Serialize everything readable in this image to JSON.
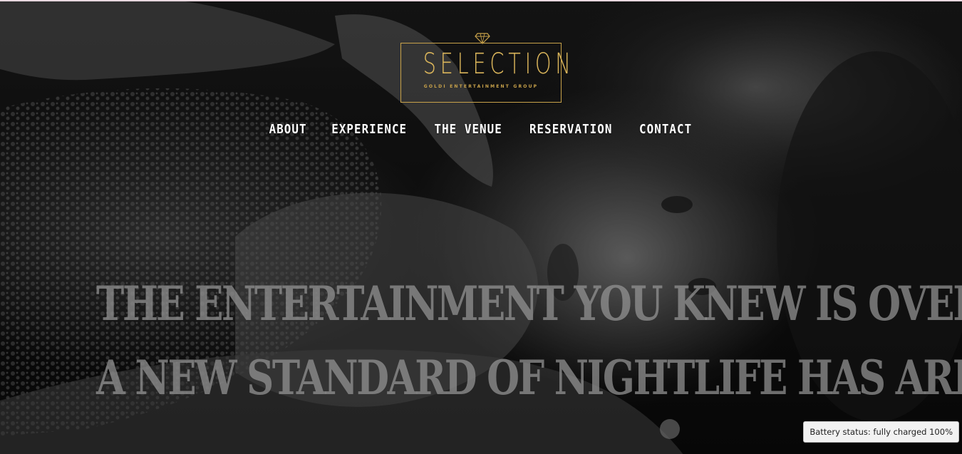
{
  "logo": {
    "wordmark": "SELECTION",
    "tagline": "GOLDI ENTERTAINMENT GROUP",
    "icon": "diamond-icon",
    "color": "#d9b45a"
  },
  "nav": {
    "items": [
      {
        "label": "ABOUT"
      },
      {
        "label": "EXPERIENCE"
      },
      {
        "label": "THE VENUE"
      },
      {
        "label": "RESERVATION"
      },
      {
        "label": "CONTACT"
      }
    ]
  },
  "hero": {
    "headline_line1": "The entertainment you knew is over –",
    "headline_line2": "A new standard of nightlife has arrived."
  },
  "system": {
    "battery_tooltip": "Battery status: fully charged 100%"
  }
}
